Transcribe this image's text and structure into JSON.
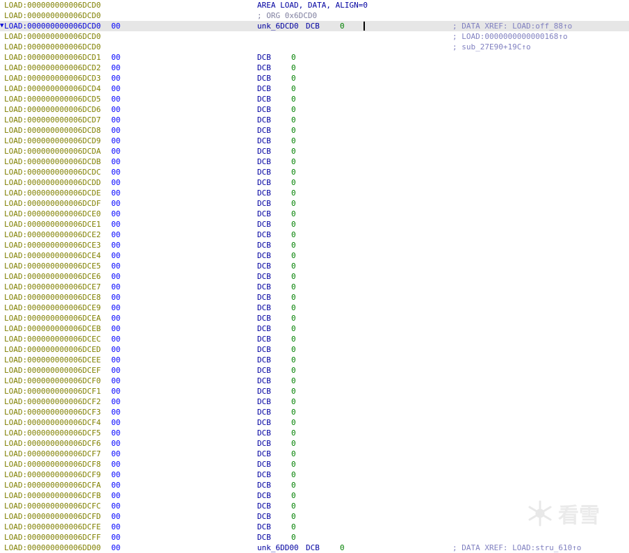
{
  "header": [
    {
      "addr": "LOAD:000000000006DCD0",
      "code": "AREA LOAD, DATA, ALIGN=0",
      "type": "dir"
    },
    {
      "addr": "LOAD:000000000006DCD0",
      "code": "; ORG 0x6DCD0",
      "type": "cmt-code"
    }
  ],
  "current_line": {
    "marker": "▼",
    "addr": "LOAD:000000000006DCD0",
    "hex": "00",
    "label": "unk_6DCD0",
    "mnemonic": "DCB",
    "value": "0",
    "comment": "; DATA XREF: LOAD:off_88↑o"
  },
  "xref_lines": [
    {
      "addr": "LOAD:000000000006DCD0",
      "comment": "; LOAD:0000000000000168↑o"
    },
    {
      "addr": "LOAD:000000000006DCD0",
      "comment": "; sub_27E90+19C↑o"
    }
  ],
  "data_lines": [
    {
      "addr": "LOAD:000000000006DCD1",
      "hex": "00",
      "mnemonic": "DCB",
      "value": "0"
    },
    {
      "addr": "LOAD:000000000006DCD2",
      "hex": "00",
      "mnemonic": "DCB",
      "value": "0"
    },
    {
      "addr": "LOAD:000000000006DCD3",
      "hex": "00",
      "mnemonic": "DCB",
      "value": "0"
    },
    {
      "addr": "LOAD:000000000006DCD4",
      "hex": "00",
      "mnemonic": "DCB",
      "value": "0"
    },
    {
      "addr": "LOAD:000000000006DCD5",
      "hex": "00",
      "mnemonic": "DCB",
      "value": "0"
    },
    {
      "addr": "LOAD:000000000006DCD6",
      "hex": "00",
      "mnemonic": "DCB",
      "value": "0"
    },
    {
      "addr": "LOAD:000000000006DCD7",
      "hex": "00",
      "mnemonic": "DCB",
      "value": "0"
    },
    {
      "addr": "LOAD:000000000006DCD8",
      "hex": "00",
      "mnemonic": "DCB",
      "value": "0"
    },
    {
      "addr": "LOAD:000000000006DCD9",
      "hex": "00",
      "mnemonic": "DCB",
      "value": "0"
    },
    {
      "addr": "LOAD:000000000006DCDA",
      "hex": "00",
      "mnemonic": "DCB",
      "value": "0"
    },
    {
      "addr": "LOAD:000000000006DCDB",
      "hex": "00",
      "mnemonic": "DCB",
      "value": "0"
    },
    {
      "addr": "LOAD:000000000006DCDC",
      "hex": "00",
      "mnemonic": "DCB",
      "value": "0"
    },
    {
      "addr": "LOAD:000000000006DCDD",
      "hex": "00",
      "mnemonic": "DCB",
      "value": "0"
    },
    {
      "addr": "LOAD:000000000006DCDE",
      "hex": "00",
      "mnemonic": "DCB",
      "value": "0"
    },
    {
      "addr": "LOAD:000000000006DCDF",
      "hex": "00",
      "mnemonic": "DCB",
      "value": "0"
    },
    {
      "addr": "LOAD:000000000006DCE0",
      "hex": "00",
      "mnemonic": "DCB",
      "value": "0"
    },
    {
      "addr": "LOAD:000000000006DCE1",
      "hex": "00",
      "mnemonic": "DCB",
      "value": "0"
    },
    {
      "addr": "LOAD:000000000006DCE2",
      "hex": "00",
      "mnemonic": "DCB",
      "value": "0"
    },
    {
      "addr": "LOAD:000000000006DCE3",
      "hex": "00",
      "mnemonic": "DCB",
      "value": "0"
    },
    {
      "addr": "LOAD:000000000006DCE4",
      "hex": "00",
      "mnemonic": "DCB",
      "value": "0"
    },
    {
      "addr": "LOAD:000000000006DCE5",
      "hex": "00",
      "mnemonic": "DCB",
      "value": "0"
    },
    {
      "addr": "LOAD:000000000006DCE6",
      "hex": "00",
      "mnemonic": "DCB",
      "value": "0"
    },
    {
      "addr": "LOAD:000000000006DCE7",
      "hex": "00",
      "mnemonic": "DCB",
      "value": "0"
    },
    {
      "addr": "LOAD:000000000006DCE8",
      "hex": "00",
      "mnemonic": "DCB",
      "value": "0"
    },
    {
      "addr": "LOAD:000000000006DCE9",
      "hex": "00",
      "mnemonic": "DCB",
      "value": "0"
    },
    {
      "addr": "LOAD:000000000006DCEA",
      "hex": "00",
      "mnemonic": "DCB",
      "value": "0"
    },
    {
      "addr": "LOAD:000000000006DCEB",
      "hex": "00",
      "mnemonic": "DCB",
      "value": "0"
    },
    {
      "addr": "LOAD:000000000006DCEC",
      "hex": "00",
      "mnemonic": "DCB",
      "value": "0"
    },
    {
      "addr": "LOAD:000000000006DCED",
      "hex": "00",
      "mnemonic": "DCB",
      "value": "0"
    },
    {
      "addr": "LOAD:000000000006DCEE",
      "hex": "00",
      "mnemonic": "DCB",
      "value": "0"
    },
    {
      "addr": "LOAD:000000000006DCEF",
      "hex": "00",
      "mnemonic": "DCB",
      "value": "0"
    },
    {
      "addr": "LOAD:000000000006DCF0",
      "hex": "00",
      "mnemonic": "DCB",
      "value": "0"
    },
    {
      "addr": "LOAD:000000000006DCF1",
      "hex": "00",
      "mnemonic": "DCB",
      "value": "0"
    },
    {
      "addr": "LOAD:000000000006DCF2",
      "hex": "00",
      "mnemonic": "DCB",
      "value": "0"
    },
    {
      "addr": "LOAD:000000000006DCF3",
      "hex": "00",
      "mnemonic": "DCB",
      "value": "0"
    },
    {
      "addr": "LOAD:000000000006DCF4",
      "hex": "00",
      "mnemonic": "DCB",
      "value": "0"
    },
    {
      "addr": "LOAD:000000000006DCF5",
      "hex": "00",
      "mnemonic": "DCB",
      "value": "0"
    },
    {
      "addr": "LOAD:000000000006DCF6",
      "hex": "00",
      "mnemonic": "DCB",
      "value": "0"
    },
    {
      "addr": "LOAD:000000000006DCF7",
      "hex": "00",
      "mnemonic": "DCB",
      "value": "0"
    },
    {
      "addr": "LOAD:000000000006DCF8",
      "hex": "00",
      "mnemonic": "DCB",
      "value": "0"
    },
    {
      "addr": "LOAD:000000000006DCF9",
      "hex": "00",
      "mnemonic": "DCB",
      "value": "0"
    },
    {
      "addr": "LOAD:000000000006DCFA",
      "hex": "00",
      "mnemonic": "DCB",
      "value": "0"
    },
    {
      "addr": "LOAD:000000000006DCFB",
      "hex": "00",
      "mnemonic": "DCB",
      "value": "0"
    },
    {
      "addr": "LOAD:000000000006DCFC",
      "hex": "00",
      "mnemonic": "DCB",
      "value": "0"
    },
    {
      "addr": "LOAD:000000000006DCFD",
      "hex": "00",
      "mnemonic": "DCB",
      "value": "0"
    },
    {
      "addr": "LOAD:000000000006DCFE",
      "hex": "00",
      "mnemonic": "DCB",
      "value": "0"
    },
    {
      "addr": "LOAD:000000000006DCFF",
      "hex": "00",
      "mnemonic": "DCB",
      "value": "0"
    }
  ],
  "next_line_partial": {
    "addr": "LOAD:000000000006DD00",
    "hex": "00",
    "label": "unk_6DD00",
    "mnemonic": "DCB",
    "value": "0",
    "comment": "; DATA XREF: LOAD:stru_610↑o"
  },
  "watermark": {
    "text": "看雪",
    "icon": "snowflake-icon"
  },
  "colors": {
    "address": "#808000",
    "hex": "#0000ff",
    "mnemonic": "#0000a0",
    "value": "#008000",
    "comment": "#8080c0",
    "highlight": "#e6e6e6"
  }
}
